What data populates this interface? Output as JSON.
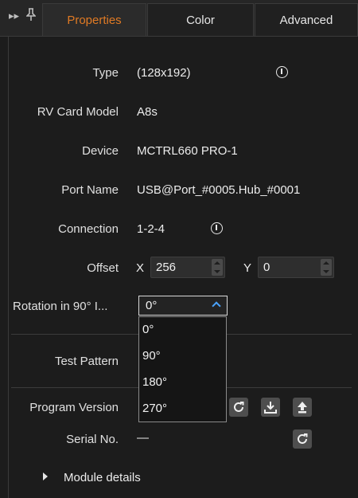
{
  "tabs": [
    {
      "label": "Properties",
      "active": true
    },
    {
      "label": "Color",
      "active": false
    },
    {
      "label": "Advanced",
      "active": false
    }
  ],
  "toolbar_icons": [
    "expand-icon",
    "pin-icon"
  ],
  "properties": {
    "type": {
      "label": "Type",
      "value": "(128x192)"
    },
    "rv_card_model": {
      "label": "RV Card Model",
      "value": "A8s"
    },
    "device": {
      "label": "Device",
      "value": "MCTRL660 PRO-1"
    },
    "port_name": {
      "label": "Port Name",
      "value": "USB@Port_#0005.Hub_#0001"
    },
    "connection": {
      "label": "Connection",
      "value": "1-2-4"
    },
    "offset": {
      "label": "Offset",
      "x_label": "X",
      "x_value": "256",
      "y_label": "Y",
      "y_value": "0"
    },
    "rotation": {
      "label": "Rotation in 90° I...",
      "selected": "0°",
      "options": [
        "0°",
        "90°",
        "180°",
        "270°"
      ]
    },
    "test_pattern": {
      "label": "Test Pattern"
    },
    "program_version": {
      "label": "Program Version"
    },
    "serial_no": {
      "label": "Serial No.",
      "value": "—"
    },
    "module_details": {
      "label": "Module details"
    }
  },
  "colors": {
    "accent": "#e07a24",
    "chevron": "#4aa3ff"
  }
}
